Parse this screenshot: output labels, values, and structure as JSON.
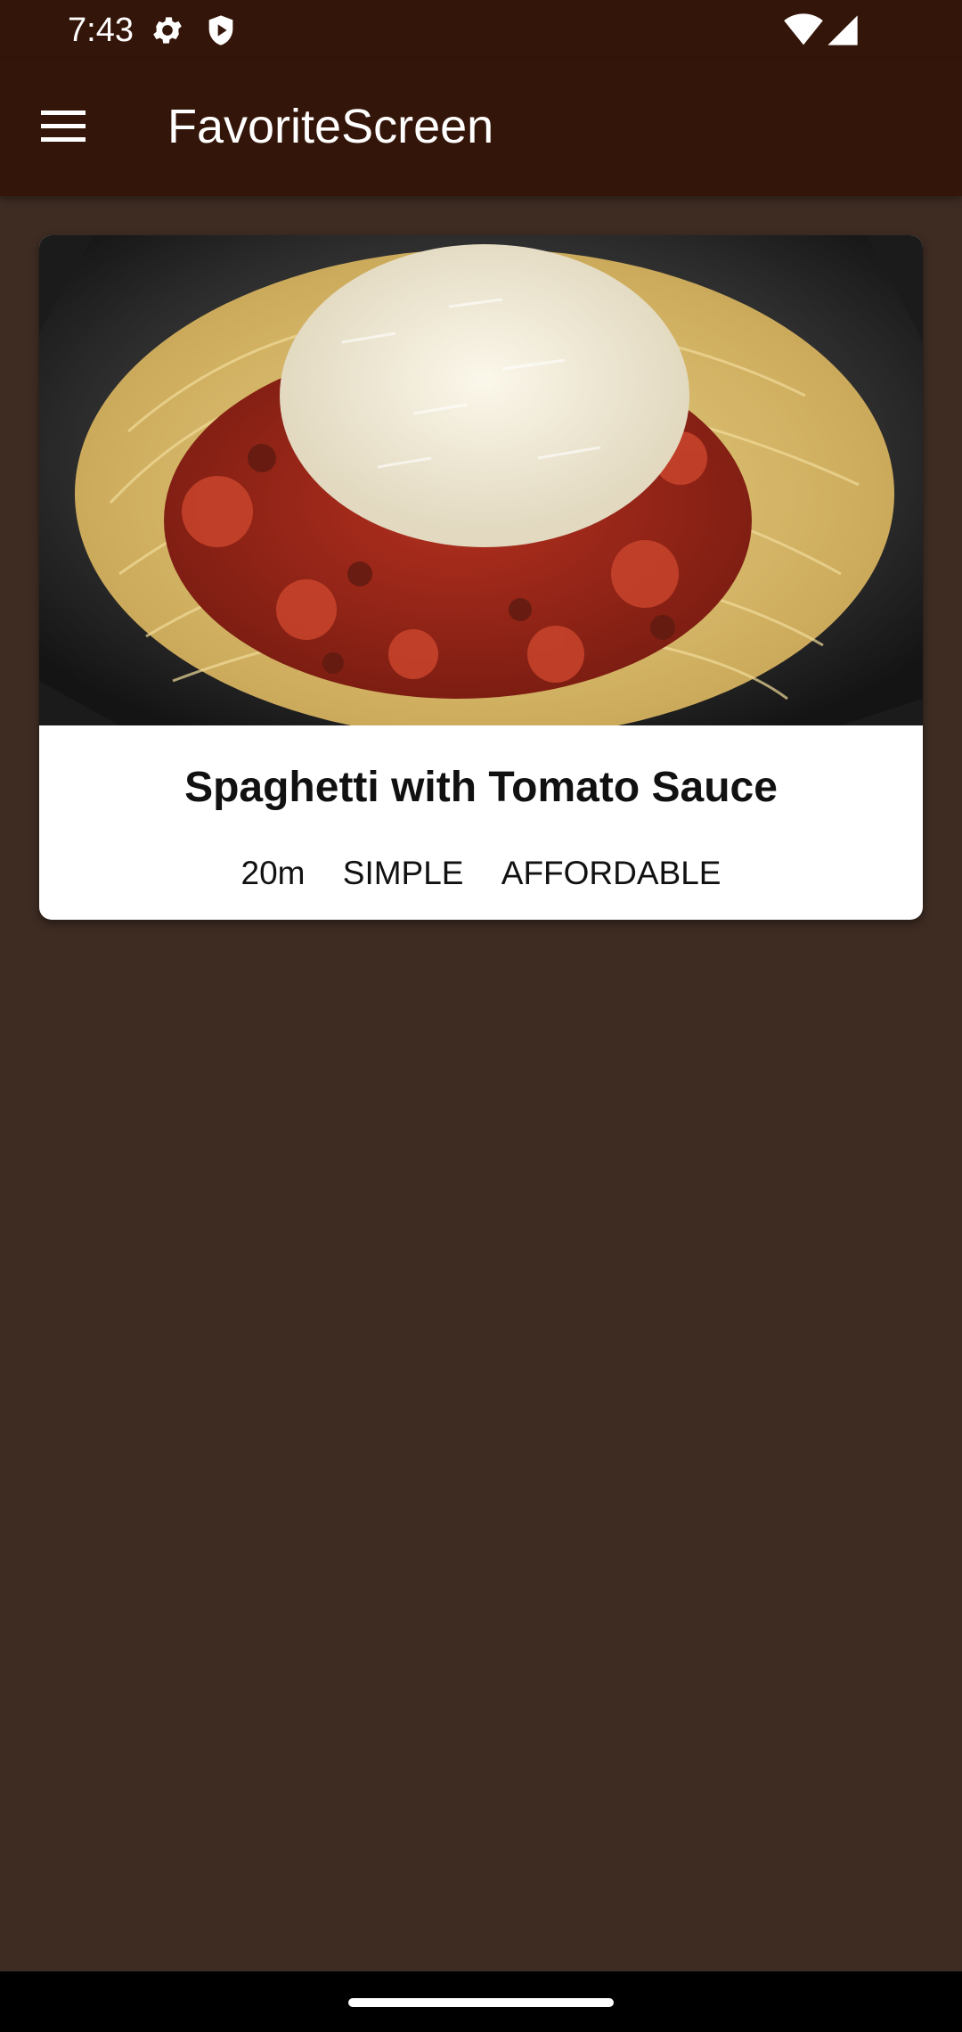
{
  "status_bar": {
    "time": "7:43",
    "icons": [
      "settings-icon",
      "shield-icon",
      "wifi-icon",
      "signal-icon"
    ]
  },
  "app_bar": {
    "menu_icon": "hamburger-menu-icon",
    "title": "FavoriteScreen"
  },
  "favorites": [
    {
      "title": "Spaghetti with Tomato Sauce",
      "duration": "20m",
      "complexity": "SIMPLE",
      "affordability": "AFFORDABLE",
      "image": "spaghetti-photo"
    }
  ],
  "colors": {
    "app_bar": "#341509",
    "background": "#3e2c23",
    "card": "#ffffff",
    "nav_bar": "#000000"
  }
}
